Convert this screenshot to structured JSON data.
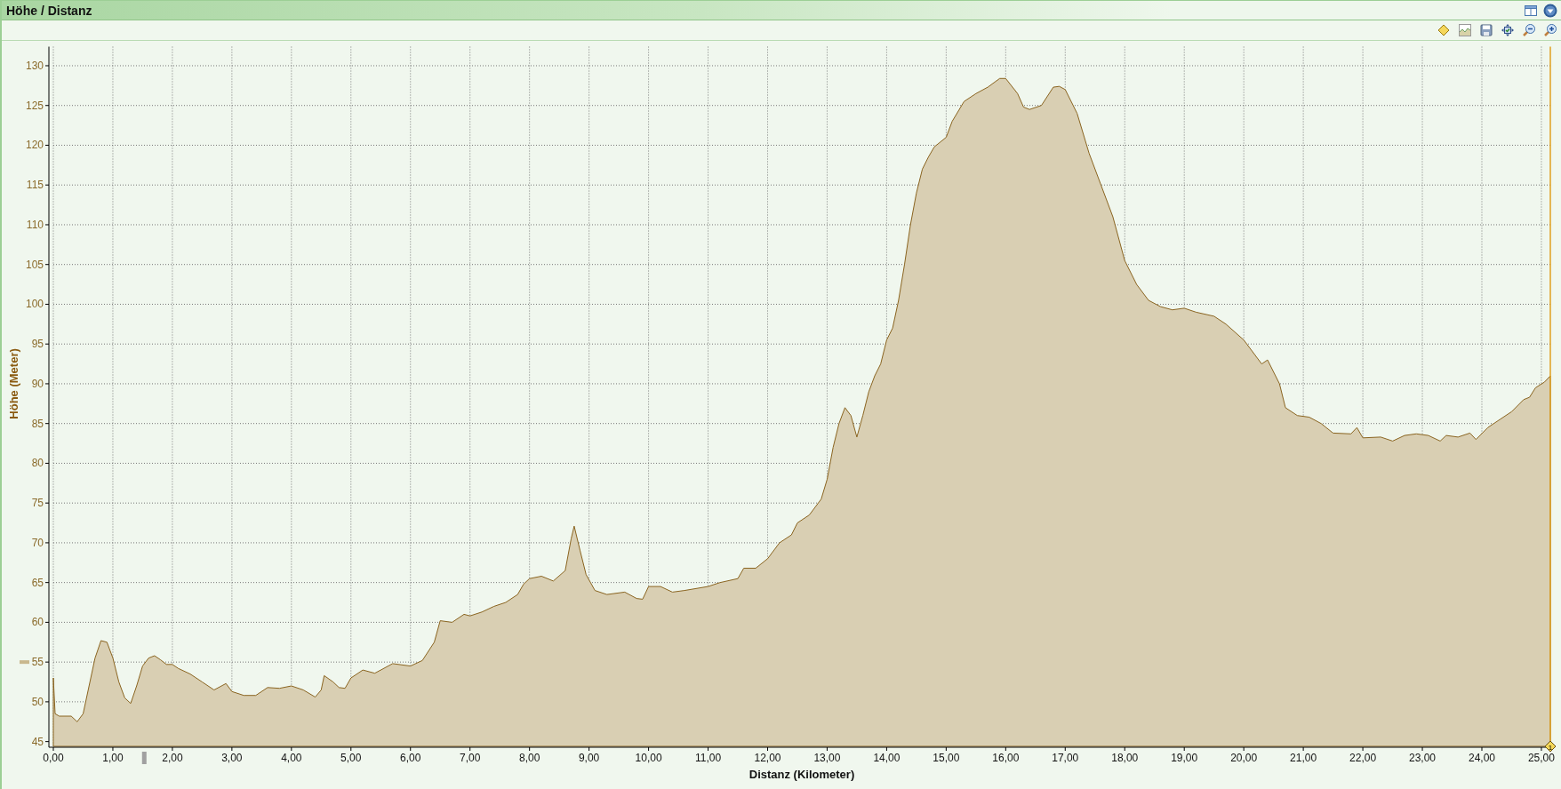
{
  "window": {
    "title": "Höhe / Distanz"
  },
  "chart": {
    "cursor": {
      "label": "1"
    },
    "chart_data": {
      "type": "area",
      "grid": true,
      "xlabel": "Distanz (Kilometer)",
      "ylabel": "Höhe (Meter)",
      "x": [
        0,
        0.03,
        0.1,
        0.3,
        0.4,
        0.5,
        0.6,
        0.7,
        0.8,
        0.9,
        1.0,
        1.1,
        1.2,
        1.3,
        1.4,
        1.5,
        1.6,
        1.7,
        1.8,
        1.9,
        2.0,
        2.1,
        2.3,
        2.5,
        2.7,
        2.9,
        3.0,
        3.2,
        3.4,
        3.6,
        3.8,
        4.0,
        4.2,
        4.4,
        4.5,
        4.55,
        4.7,
        4.8,
        4.9,
        5.0,
        5.2,
        5.4,
        5.7,
        6.0,
        6.2,
        6.4,
        6.5,
        6.7,
        6.9,
        7.0,
        7.2,
        7.4,
        7.6,
        7.8,
        7.9,
        8.0,
        8.2,
        8.4,
        8.6,
        8.7,
        8.75,
        8.85,
        8.95,
        9.1,
        9.3,
        9.6,
        9.8,
        9.9,
        10.0,
        10.2,
        10.4,
        10.6,
        11.0,
        11.2,
        11.5,
        11.6,
        11.8,
        12.0,
        12.2,
        12.4,
        12.5,
        12.7,
        12.9,
        13.0,
        13.1,
        13.2,
        13.3,
        13.4,
        13.5,
        13.6,
        13.7,
        13.8,
        13.9,
        14.0,
        14.1,
        14.2,
        14.3,
        14.4,
        14.5,
        14.6,
        14.7,
        14.8,
        15.0,
        15.1,
        15.3,
        15.5,
        15.7,
        15.9,
        16.0,
        16.2,
        16.3,
        16.4,
        16.6,
        16.8,
        16.9,
        17.0,
        17.2,
        17.4,
        17.6,
        17.8,
        18.0,
        18.2,
        18.4,
        18.6,
        18.8,
        19.0,
        19.2,
        19.5,
        19.7,
        20.0,
        20.3,
        20.4,
        20.6,
        20.7,
        20.9,
        21.1,
        21.3,
        21.5,
        21.8,
        21.9,
        22.0,
        22.3,
        22.5,
        22.7,
        22.9,
        23.1,
        23.3,
        23.4,
        23.6,
        23.8,
        23.9,
        24.1,
        24.3,
        24.5,
        24.7,
        24.8,
        24.9,
        25.05,
        25.15
      ],
      "series": [
        {
          "color": "#d9cfb3",
          "values": [
            53,
            48.5,
            48.2,
            48.2,
            47.5,
            48.5,
            52,
            55.5,
            57.7,
            57.5,
            55.5,
            52.5,
            50.5,
            49.8,
            52,
            54.5,
            55.5,
            55.8,
            55.3,
            54.7,
            54.7,
            54.2,
            53.5,
            52.5,
            51.5,
            52.3,
            51.3,
            50.8,
            50.8,
            51.8,
            51.7,
            52,
            51.5,
            50.6,
            51.5,
            53.3,
            52.5,
            51.8,
            51.7,
            53,
            54,
            53.6,
            54.8,
            54.5,
            55.2,
            57.5,
            60.2,
            60,
            61,
            60.8,
            61.3,
            62,
            62.5,
            63.5,
            64.8,
            65.5,
            65.8,
            65.2,
            66.5,
            70.5,
            72.1,
            69,
            66,
            64,
            63.5,
            63.8,
            63,
            62.9,
            64.5,
            64.5,
            63.8,
            64,
            64.5,
            65,
            65.5,
            66.8,
            66.8,
            68,
            70,
            71,
            72.5,
            73.5,
            75.5,
            78,
            82,
            85,
            87,
            86,
            83.3,
            86,
            89,
            91,
            92.5,
            95.5,
            97,
            100.5,
            105,
            110,
            114,
            117,
            118.5,
            119.8,
            121,
            123,
            125.5,
            126.5,
            127.3,
            128.4,
            128.4,
            126.5,
            124.8,
            124.5,
            125,
            127.3,
            127.4,
            127,
            124,
            119,
            115,
            111,
            105.5,
            102.5,
            100.5,
            99.7,
            99.3,
            99.5,
            99,
            98.5,
            97.5,
            95.5,
            92.5,
            93,
            90,
            87,
            86,
            85.8,
            85,
            83.8,
            83.7,
            84.5,
            83.2,
            83.3,
            82.8,
            83.5,
            83.7,
            83.5,
            82.8,
            83.5,
            83.3,
            83.8,
            83,
            84.5,
            85.5,
            86.5,
            88,
            88.3,
            89.5,
            90.2,
            91
          ]
        }
      ],
      "xlim": [
        0,
        25.15
      ],
      "ylim": [
        44.4,
        132.4
      ],
      "xticks": [
        {
          "value": 0,
          "label": "0,00"
        },
        {
          "value": 1,
          "label": "1,00"
        },
        {
          "value": 2,
          "label": "2,00"
        },
        {
          "value": 3,
          "label": "3,00"
        },
        {
          "value": 4,
          "label": "4,00"
        },
        {
          "value": 5,
          "label": "5,00"
        },
        {
          "value": 6,
          "label": "6,00"
        },
        {
          "value": 7,
          "label": "7,00"
        },
        {
          "value": 8,
          "label": "8,00"
        },
        {
          "value": 9,
          "label": "9,00"
        },
        {
          "value": 10,
          "label": "10,00"
        },
        {
          "value": 11,
          "label": "11,00"
        },
        {
          "value": 12,
          "label": "12,00"
        },
        {
          "value": 13,
          "label": "13,00"
        },
        {
          "value": 14,
          "label": "14,00"
        },
        {
          "value": 15,
          "label": "15,00"
        },
        {
          "value": 16,
          "label": "16,00"
        },
        {
          "value": 17,
          "label": "17,00"
        },
        {
          "value": 18,
          "label": "18,00"
        },
        {
          "value": 19,
          "label": "19,00"
        },
        {
          "value": 20,
          "label": "20,00"
        },
        {
          "value": 21,
          "label": "21,00"
        },
        {
          "value": 22,
          "label": "22,00"
        },
        {
          "value": 23,
          "label": "23,00"
        },
        {
          "value": 24,
          "label": "24,00"
        },
        {
          "value": 25,
          "label": "25,00"
        }
      ],
      "yticks": [
        45,
        50,
        55,
        60,
        65,
        70,
        75,
        80,
        85,
        90,
        95,
        100,
        105,
        110,
        115,
        120,
        125,
        130
      ]
    }
  }
}
